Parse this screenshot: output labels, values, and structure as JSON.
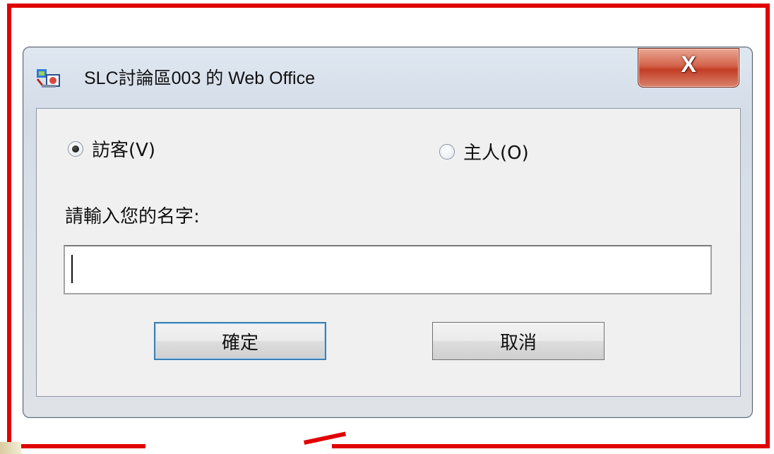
{
  "window": {
    "title": "SLC討論區003 的 Web Office",
    "icon": "web-office-app-icon",
    "close_glyph": "X"
  },
  "role_options": [
    {
      "label": "訪客(V)",
      "checked": true
    },
    {
      "label": "主人(O)",
      "checked": false
    }
  ],
  "name_prompt": "請輸入您的名字:",
  "name_input": {
    "value": "",
    "placeholder": ""
  },
  "buttons": {
    "ok": "確定",
    "cancel": "取消"
  },
  "colors": {
    "highlight_frame": "#e00000",
    "close_button": "#c33d25"
  }
}
